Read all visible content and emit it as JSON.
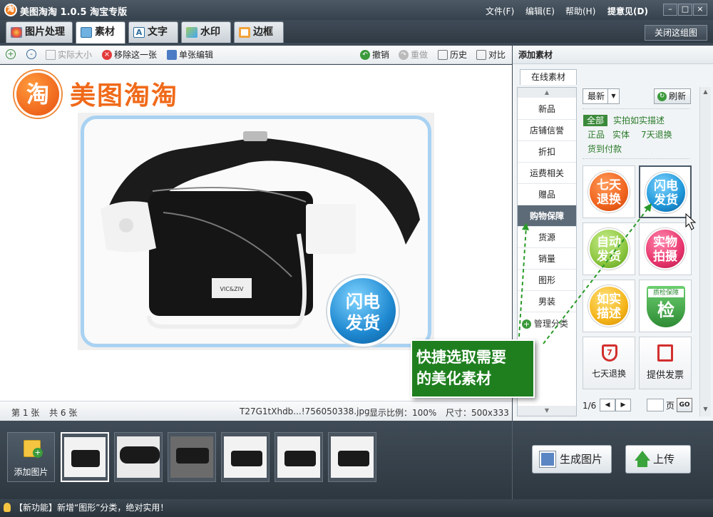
{
  "app": {
    "title": "美图淘淘 1.0.5 淘宝专版",
    "icon_glyph": "淘"
  },
  "menu": {
    "file": "文件(F)",
    "edit": "编辑(E)",
    "help": "帮助(H)",
    "feedback": "提意见(D)"
  },
  "window": {
    "minimize": "–",
    "maximize": "□",
    "close": "×"
  },
  "tabs": [
    {
      "label": "图片处理"
    },
    {
      "label": "素材"
    },
    {
      "label": "文字"
    },
    {
      "label": "水印"
    },
    {
      "label": "边框"
    }
  ],
  "close_group": "关闭这组图",
  "toolbar": {
    "actual_size": "实际大小",
    "remove_one": "移除这一张",
    "single_edit": "单张编辑",
    "undo": "撤销",
    "redo": "重做",
    "history": "历史",
    "compare": "对比"
  },
  "canvas": {
    "logo_text": "美图淘淘",
    "logo_glyph": "淘",
    "watermark_badge": [
      "闪电",
      "发货"
    ],
    "bag_label": "VIC&ZIV"
  },
  "status": {
    "current": "第 1 张",
    "total": "共 6 张",
    "filename": "T27G1tXhdb...!756050338.jpg",
    "zoom": "显示比例：100%",
    "size": "尺寸：500x333"
  },
  "panel": {
    "title": "添加素材",
    "online_tab": "在线素材",
    "sort_value": "最新",
    "refresh": "刷新",
    "filters": [
      "全部",
      "实拍如实描述",
      "正品",
      "实体",
      "7天退换",
      "货到付款"
    ],
    "categories": [
      "新品",
      "店铺信誉",
      "折扣",
      "运费相关",
      "赠品",
      "购物保障",
      "货源",
      "销量",
      "图形",
      "男装"
    ],
    "manage": "管理分类",
    "materials": [
      {
        "lines": [
          "七天",
          "退换"
        ],
        "color": "#f0641e"
      },
      {
        "lines": [
          "闪电",
          "发货"
        ],
        "color": "#1e96d8"
      },
      {
        "lines": [
          "自动",
          "发货"
        ],
        "color": "#8cc63f"
      },
      {
        "lines": [
          "实物",
          "拍摄"
        ],
        "color": "#e8356d"
      },
      {
        "lines": [
          "如实",
          "描述"
        ],
        "color": "#f5b51a"
      },
      {
        "lines": [
          "质检保障",
          "检"
        ],
        "color": "#4caf50"
      },
      {
        "lines": [
          "七天退换"
        ],
        "color": "#d32f2f"
      },
      {
        "lines": [
          "提供发票"
        ],
        "color": "#d32f2f"
      }
    ],
    "pager": {
      "page": "1/6",
      "page_label": "页",
      "go": "GO"
    }
  },
  "callout": [
    "快捷选取需要",
    "的美化素材"
  ],
  "bottom": {
    "add_picture": "添加图片",
    "generate": "生成图片",
    "upload": "上传"
  },
  "news": "【新功能】新增“图形”分类，绝对实用！",
  "colors": {
    "accent_green": "#1f7f1f",
    "title_bar": "#3d4a56",
    "logo_orange": "#f07a1a"
  }
}
